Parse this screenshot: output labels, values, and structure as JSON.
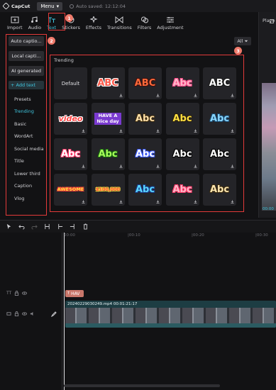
{
  "titlebar": {
    "app_name": "CapCut",
    "menu_label": "Menu",
    "autosave_text": "Auto saved: 12:12:04"
  },
  "toolbar": {
    "tabs": [
      {
        "label": "Import",
        "icon": "import-icon"
      },
      {
        "label": "Audio",
        "icon": "audio-icon"
      },
      {
        "label": "Text",
        "icon": "text-icon",
        "active": true
      },
      {
        "label": "Stickers",
        "icon": "sticker-icon"
      },
      {
        "label": "Effects",
        "icon": "effects-icon"
      },
      {
        "label": "Transitions",
        "icon": "transitions-icon"
      },
      {
        "label": "Filters",
        "icon": "filters-icon"
      },
      {
        "label": "Adjustment",
        "icon": "adjustment-icon"
      }
    ]
  },
  "badges": {
    "one": "1",
    "two": "2",
    "three": "3"
  },
  "leftnav": {
    "buttons": [
      "Auto captio...",
      "Local capti...",
      "AI generated"
    ],
    "add_text": "+ Add text",
    "items": [
      "Presets",
      "Trending",
      "Basic",
      "WordArt",
      "Social media",
      "Title",
      "Lower third",
      "Caption",
      "Vlog"
    ],
    "active_item": "Trending"
  },
  "grid": {
    "heading": "Trending",
    "filter_label": "All",
    "tiles": [
      {
        "text": "Default",
        "style": "default"
      },
      {
        "text": "ABC",
        "color": "#ff5a4a",
        "stroke": "#ffffff"
      },
      {
        "text": "ABC",
        "color": "#ff6a3a",
        "stroke": "#3a1010"
      },
      {
        "text": "Abc",
        "color": "#ffb8c8",
        "stroke": "#ff4a8a"
      },
      {
        "text": "ABC",
        "color": "#ffffff",
        "stroke": "#1a1a1a"
      },
      {
        "text": "video",
        "color": "#ff4a4a",
        "stroke": "#ffffff"
      },
      {
        "text": "HAVE A Nice day",
        "color": "#ffffff",
        "stroke": "#7a3ad0"
      },
      {
        "text": "Abc",
        "color": "#ffe0a8",
        "stroke": "#3a2a10"
      },
      {
        "text": "Abc",
        "color": "#ffe040",
        "stroke": "#2a2010"
      },
      {
        "text": "Abc",
        "color": "#8ad8ff",
        "stroke": "#1a4a70"
      },
      {
        "text": "Abc",
        "color": "#ffffff",
        "stroke": "#ff3a6a"
      },
      {
        "text": "Abc",
        "color": "#a8ff5a",
        "stroke": "#1a6a10"
      },
      {
        "text": "Abc",
        "color": "#ffffff",
        "stroke": "#3a5aff"
      },
      {
        "text": "Abc",
        "color": "#ffffff",
        "stroke": "#000000"
      },
      {
        "text": "Abc",
        "color": "#ffffff",
        "stroke": "#000000"
      },
      {
        "text": "AWESOME",
        "color": "#ffe040",
        "stroke": "#ff3a3a"
      },
      {
        "text": "$100,000",
        "color": "#ff4a3a",
        "stroke": "#ffe040"
      },
      {
        "text": "Abc",
        "color": "#5ad8ff",
        "stroke": "#1a3a8a"
      },
      {
        "text": "Abc",
        "color": "#ffb8c8",
        "stroke": "#ff3a6a"
      },
      {
        "text": "Abc",
        "color": "#ffe8b0",
        "stroke": "#3a2a10"
      }
    ]
  },
  "player": {
    "label": "Playe",
    "time": "00:00"
  },
  "timeline": {
    "ruler": [
      "00:00",
      "|00:10",
      "|00:20",
      "|00:30"
    ],
    "text_clip_label": "HAV",
    "video_clip_label": "20240229030249.mp4  00:01:21:17"
  },
  "colors": {
    "accent": "#3fc7e0",
    "highlight": "#e33a3a",
    "badge": "#ef7a6b"
  }
}
